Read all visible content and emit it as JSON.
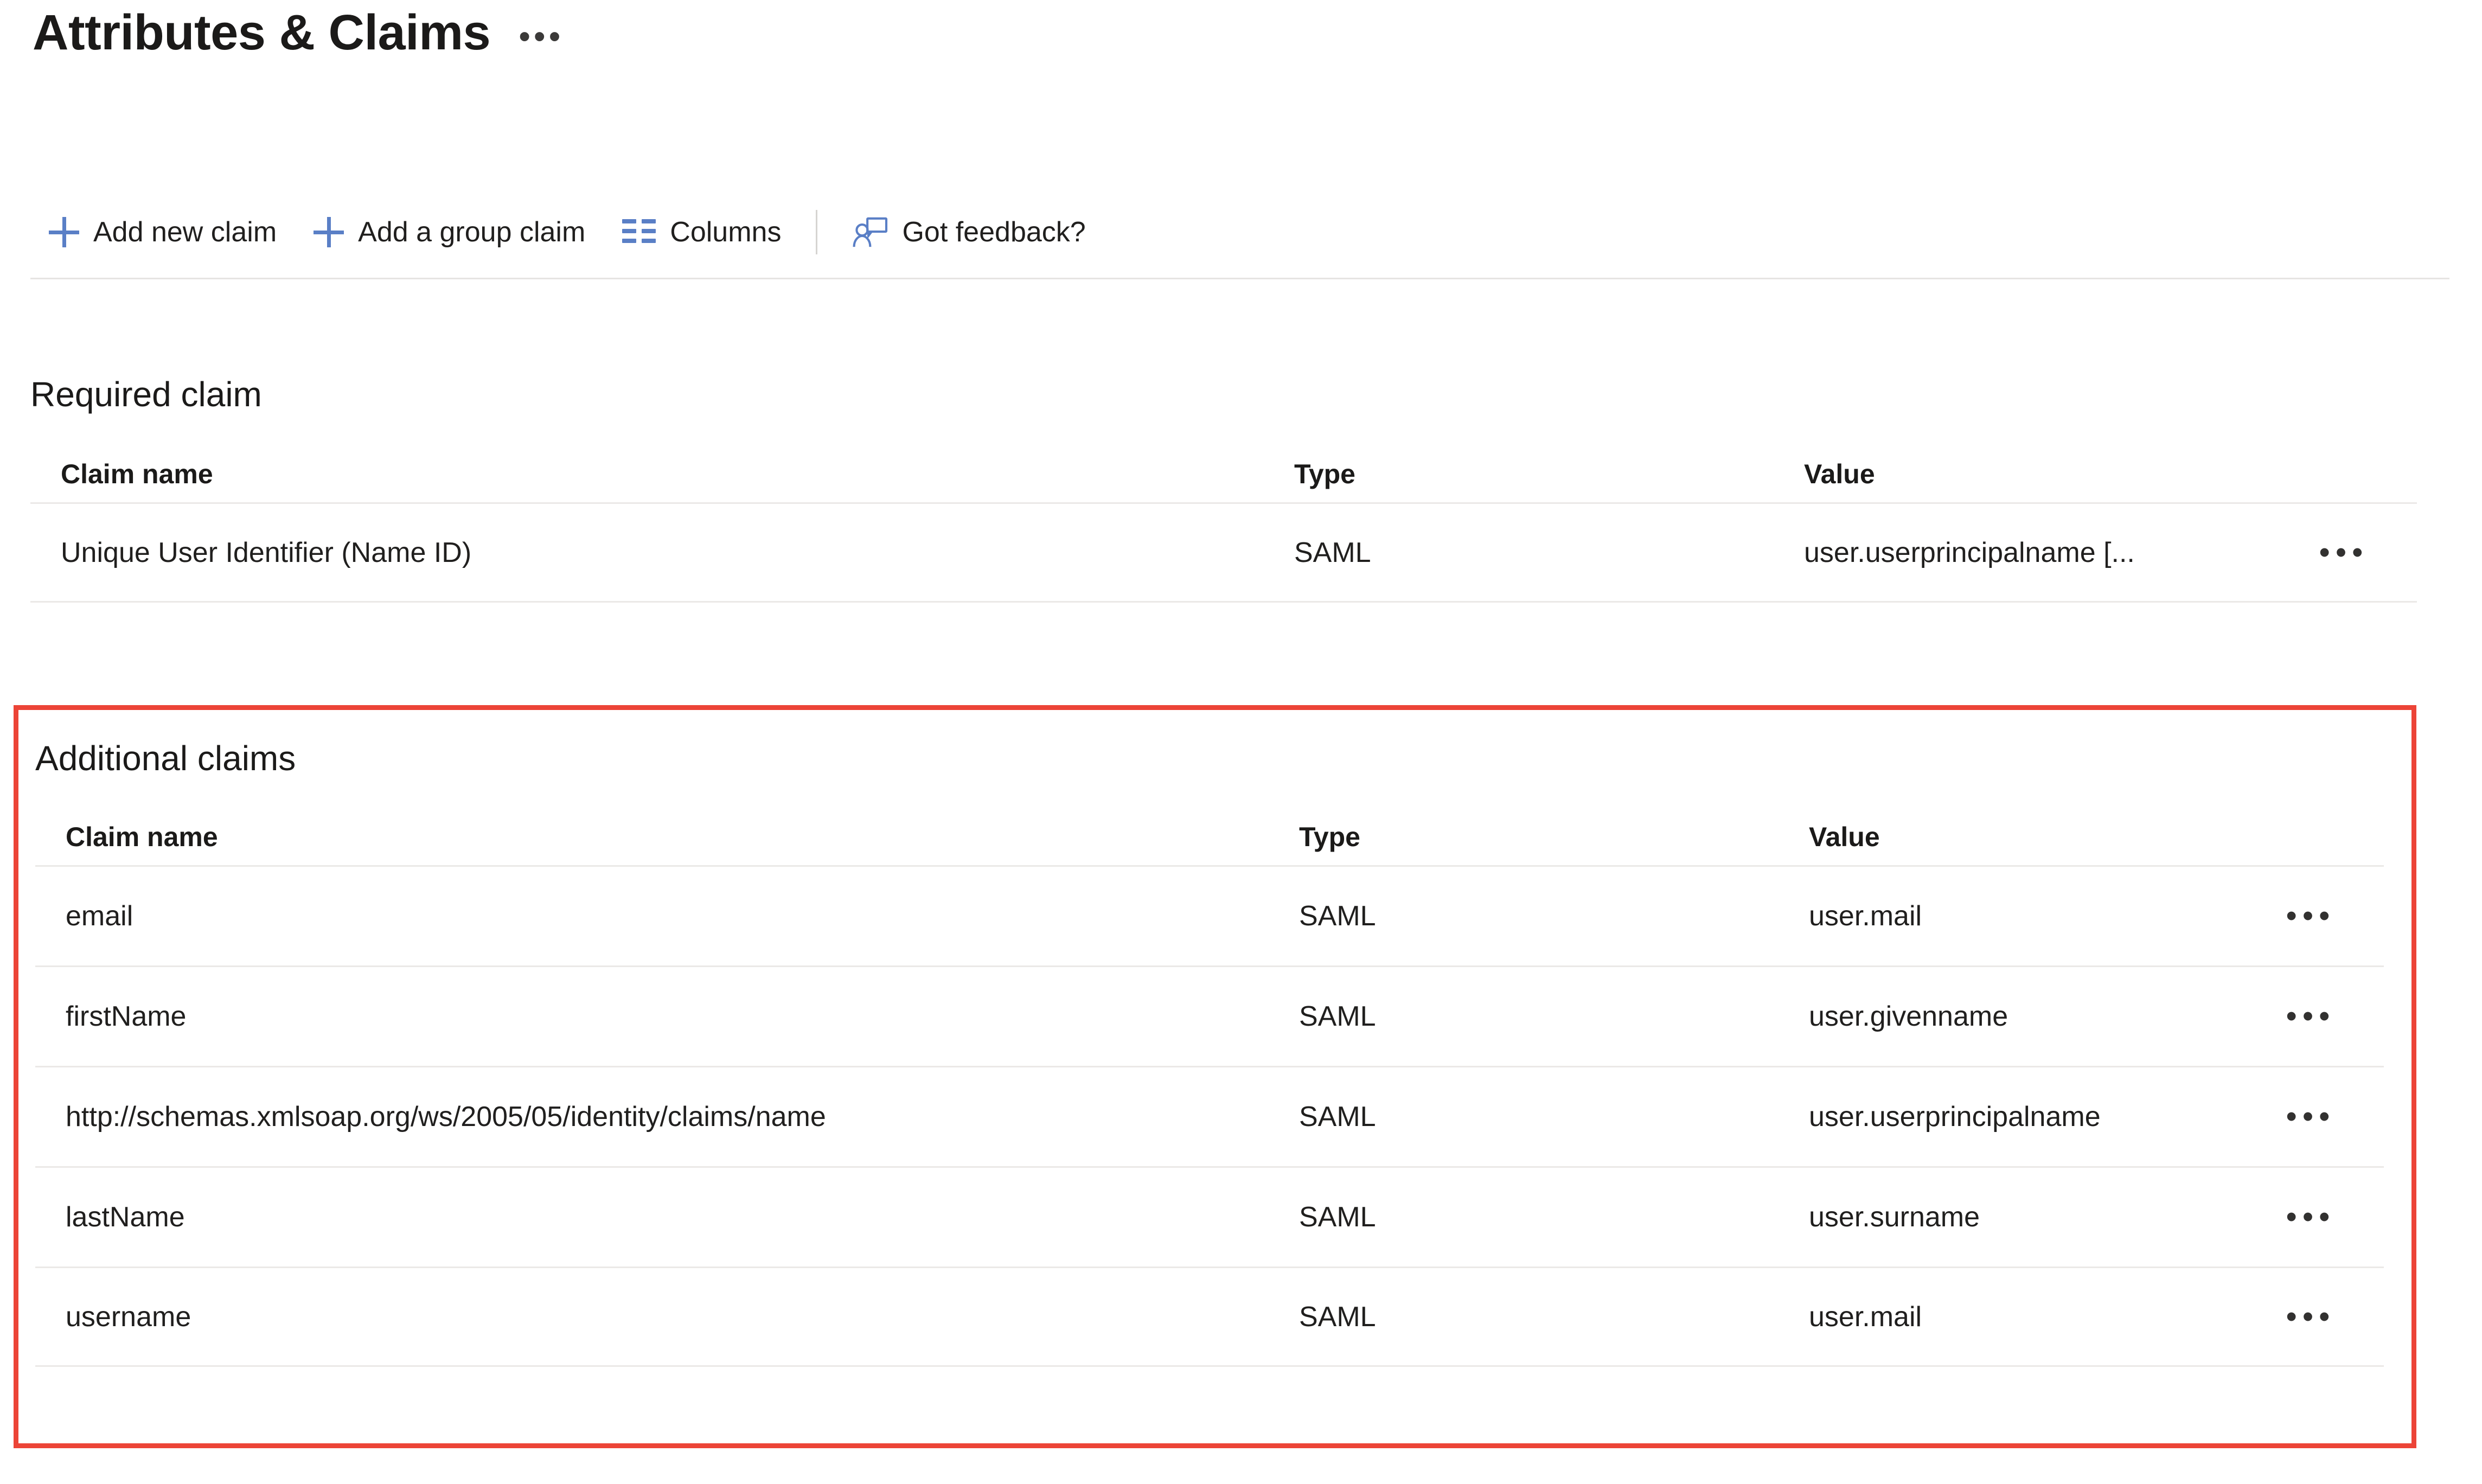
{
  "header": {
    "title": "Attributes & Claims",
    "overflow_menu": "•••"
  },
  "toolbar": {
    "add_new_claim": "Add new claim",
    "add_group_claim": "Add a group claim",
    "columns": "Columns",
    "got_feedback": "Got feedback?",
    "icons": {
      "add_new_claim": "plus-icon",
      "add_group_claim": "plus-icon",
      "columns": "columns-icon",
      "got_feedback": "person-feedback-icon"
    },
    "accent_color": "#5a7fc6"
  },
  "required_claim": {
    "heading": "Required claim",
    "columns": {
      "name": "Claim name",
      "type": "Type",
      "value": "Value"
    },
    "rows": [
      {
        "name": "Unique User Identifier (Name ID)",
        "type": "SAML",
        "value": "user.userprincipalname [...",
        "menu": "•••"
      }
    ]
  },
  "additional_claims": {
    "heading": "Additional claims",
    "highlight_color": "#ec4437",
    "columns": {
      "name": "Claim name",
      "type": "Type",
      "value": "Value"
    },
    "rows": [
      {
        "name": "email",
        "type": "SAML",
        "value": "user.mail",
        "menu": "•••"
      },
      {
        "name": "firstName",
        "type": "SAML",
        "value": "user.givenname",
        "menu": "•••"
      },
      {
        "name": "http://schemas.xmlsoap.org/ws/2005/05/identity/claims/name",
        "type": "SAML",
        "value": "user.userprincipalname",
        "menu": "•••"
      },
      {
        "name": "lastName",
        "type": "SAML",
        "value": "user.surname",
        "menu": "•••"
      },
      {
        "name": "username",
        "type": "SAML",
        "value": "user.mail",
        "menu": "•••"
      }
    ]
  }
}
